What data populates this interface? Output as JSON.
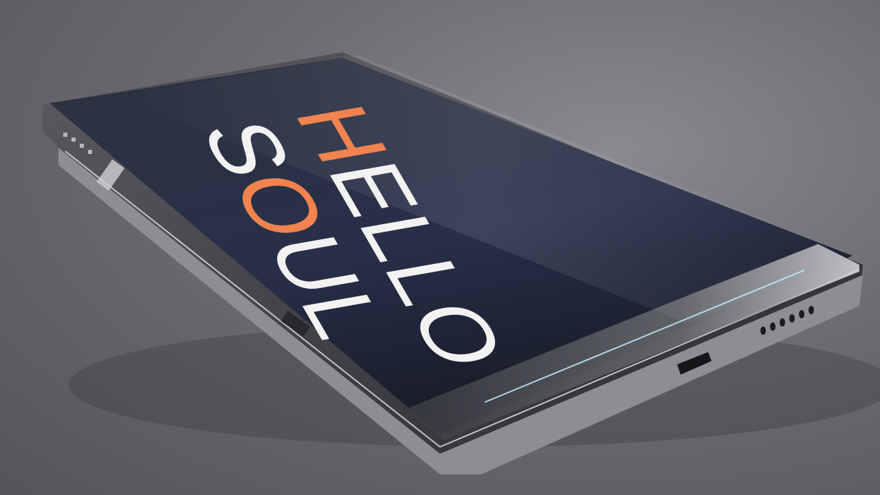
{
  "scene": {
    "subject": "smartphone-render",
    "background_color": "#6c6b72",
    "screen_color": "#1e2330",
    "accent_color": "#f0834f",
    "text_color": "#f2f2f2"
  },
  "screen": {
    "line1": {
      "first": "H",
      "rest": "ELLO"
    },
    "line2": {
      "first": "S",
      "accent": "O",
      "rest": "UL"
    }
  }
}
